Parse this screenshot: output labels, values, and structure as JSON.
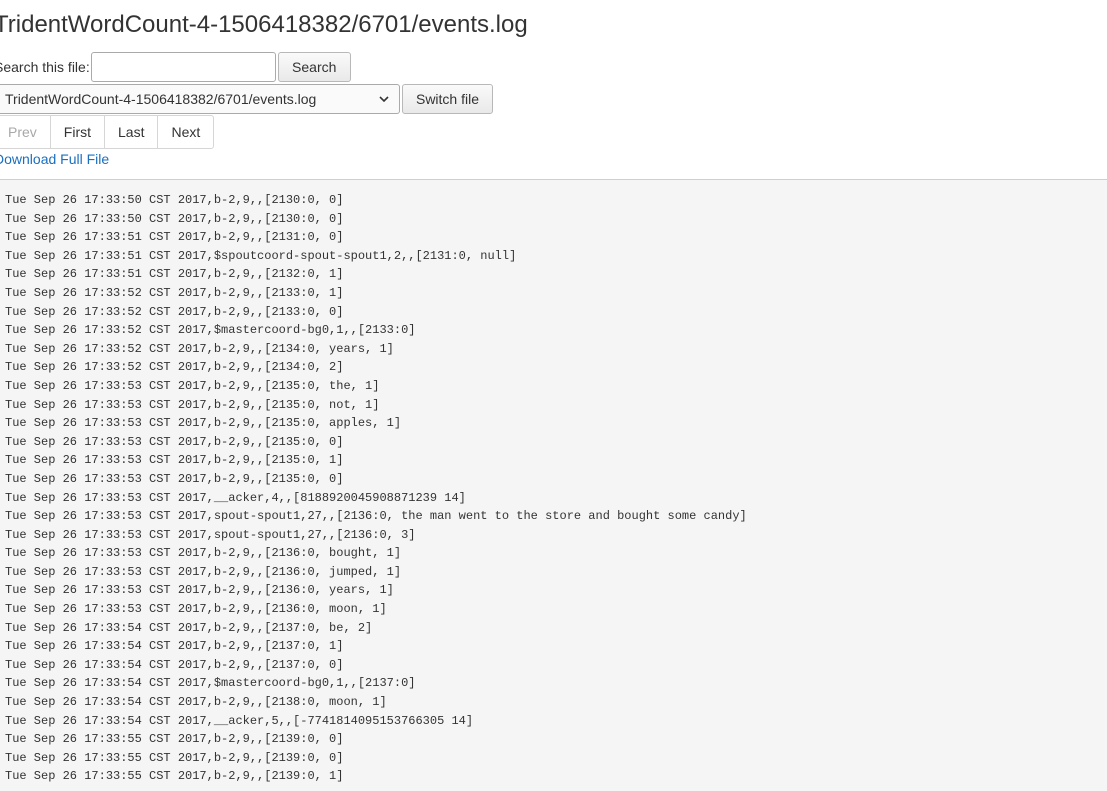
{
  "page": {
    "title": "TridentWordCount-4-1506418382/6701/events.log"
  },
  "search": {
    "label": "Search this file:",
    "value": "",
    "placeholder": "",
    "button_label": "Search"
  },
  "file_switch": {
    "selected": "TridentWordCount-4-1506418382/6701/events.log",
    "button_label": "Switch file"
  },
  "pager": {
    "prev": "Prev",
    "first": "First",
    "last": "Last",
    "next": "Next"
  },
  "download": {
    "label": "Download Full File"
  },
  "log": {
    "lines": [
      "Tue Sep 26 17:33:50 CST 2017,b-2,9,,[2130:0, 0]",
      "Tue Sep 26 17:33:50 CST 2017,b-2,9,,[2130:0, 0]",
      "Tue Sep 26 17:33:51 CST 2017,b-2,9,,[2131:0, 0]",
      "Tue Sep 26 17:33:51 CST 2017,$spoutcoord-spout-spout1,2,,[2131:0, null]",
      "Tue Sep 26 17:33:51 CST 2017,b-2,9,,[2132:0, 1]",
      "Tue Sep 26 17:33:52 CST 2017,b-2,9,,[2133:0, 1]",
      "Tue Sep 26 17:33:52 CST 2017,b-2,9,,[2133:0, 0]",
      "Tue Sep 26 17:33:52 CST 2017,$mastercoord-bg0,1,,[2133:0]",
      "Tue Sep 26 17:33:52 CST 2017,b-2,9,,[2134:0, years, 1]",
      "Tue Sep 26 17:33:52 CST 2017,b-2,9,,[2134:0, 2]",
      "Tue Sep 26 17:33:53 CST 2017,b-2,9,,[2135:0, the, 1]",
      "Tue Sep 26 17:33:53 CST 2017,b-2,9,,[2135:0, not, 1]",
      "Tue Sep 26 17:33:53 CST 2017,b-2,9,,[2135:0, apples, 1]",
      "Tue Sep 26 17:33:53 CST 2017,b-2,9,,[2135:0, 0]",
      "Tue Sep 26 17:33:53 CST 2017,b-2,9,,[2135:0, 1]",
      "Tue Sep 26 17:33:53 CST 2017,b-2,9,,[2135:0, 0]",
      "Tue Sep 26 17:33:53 CST 2017,__acker,4,,[8188920045908871239 14]",
      "Tue Sep 26 17:33:53 CST 2017,spout-spout1,27,,[2136:0, the man went to the store and bought some candy]",
      "Tue Sep 26 17:33:53 CST 2017,spout-spout1,27,,[2136:0, 3]",
      "Tue Sep 26 17:33:53 CST 2017,b-2,9,,[2136:0, bought, 1]",
      "Tue Sep 26 17:33:53 CST 2017,b-2,9,,[2136:0, jumped, 1]",
      "Tue Sep 26 17:33:53 CST 2017,b-2,9,,[2136:0, years, 1]",
      "Tue Sep 26 17:33:53 CST 2017,b-2,9,,[2136:0, moon, 1]",
      "Tue Sep 26 17:33:54 CST 2017,b-2,9,,[2137:0, be, 2]",
      "Tue Sep 26 17:33:54 CST 2017,b-2,9,,[2137:0, 1]",
      "Tue Sep 26 17:33:54 CST 2017,b-2,9,,[2137:0, 0]",
      "Tue Sep 26 17:33:54 CST 2017,$mastercoord-bg0,1,,[2137:0]",
      "Tue Sep 26 17:33:54 CST 2017,b-2,9,,[2138:0, moon, 1]",
      "Tue Sep 26 17:33:54 CST 2017,__acker,5,,[-7741814095153766305 14]",
      "Tue Sep 26 17:33:55 CST 2017,b-2,9,,[2139:0, 0]",
      "Tue Sep 26 17:33:55 CST 2017,b-2,9,,[2139:0, 0]",
      "Tue Sep 26 17:33:55 CST 2017,b-2,9,,[2139:0, 1]"
    ]
  }
}
